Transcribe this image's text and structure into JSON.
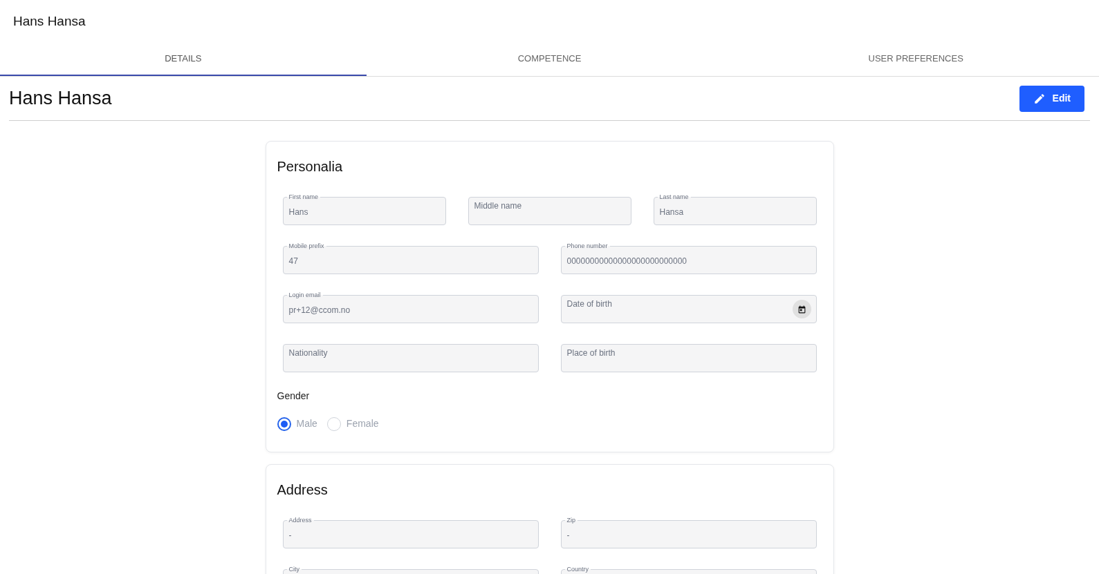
{
  "app_bar": {
    "title": "Hans Hansa"
  },
  "tabs": [
    {
      "label": "DETAILS",
      "selected": true
    },
    {
      "label": "COMPETENCE",
      "selected": false
    },
    {
      "label": "USER PREFERENCES",
      "selected": false
    }
  ],
  "page_header": {
    "title": "Hans Hansa",
    "edit_button": "Edit"
  },
  "sections": [
    {
      "title": "Personalia",
      "rows": [
        [
          {
            "kind": "text",
            "label": "First name",
            "value": "Hans"
          },
          {
            "kind": "text",
            "placeholder": "Middle name"
          },
          {
            "kind": "text",
            "label": "Last name",
            "value": "Hansa"
          }
        ],
        [
          {
            "kind": "text",
            "label": "Mobile prefix",
            "value": "47"
          },
          {
            "kind": "text",
            "label": "Phone number",
            "value": "00000000000000000000000000"
          }
        ],
        [
          {
            "kind": "text",
            "label": "Login email",
            "value": "pr+12@ccom.no"
          },
          {
            "kind": "date",
            "placeholder": "Date of birth"
          }
        ],
        [
          {
            "kind": "text",
            "placeholder": "Nationality"
          },
          {
            "kind": "text",
            "placeholder": "Place of birth"
          }
        ]
      ],
      "gender": {
        "label": "Gender",
        "options": [
          {
            "label": "Male",
            "selected": true
          },
          {
            "label": "Female",
            "selected": false
          }
        ]
      }
    },
    {
      "title": "Address",
      "rows": [
        [
          {
            "kind": "text",
            "label": "Address",
            "value": "-"
          },
          {
            "kind": "text",
            "label": "Zip",
            "value": "-"
          }
        ],
        [
          {
            "kind": "text",
            "label": "City"
          },
          {
            "kind": "text",
            "label": "Country"
          }
        ]
      ]
    }
  ]
}
